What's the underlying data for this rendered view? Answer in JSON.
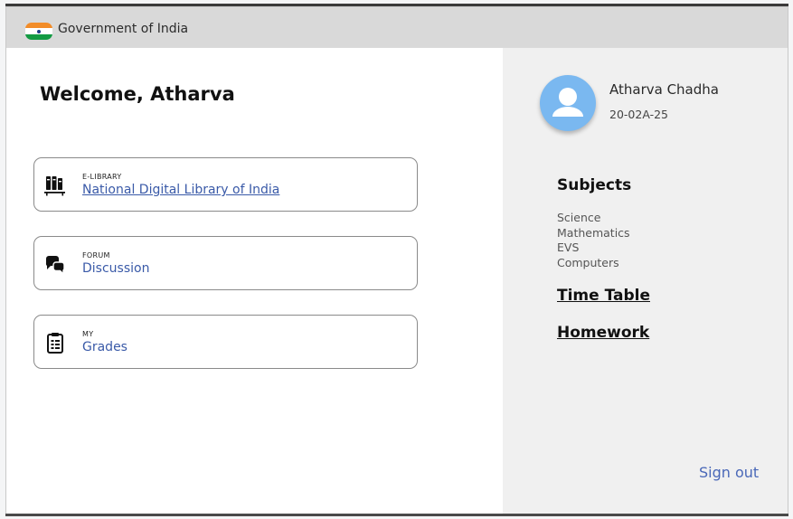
{
  "gov_bar": {
    "label": "Government of India"
  },
  "main": {
    "welcome": "Welcome, Atharva",
    "cards": [
      {
        "tag": "E-LIBRARY",
        "link": "National Digital Library of India",
        "icon": "books-icon"
      },
      {
        "tag": "FORUM",
        "link": "Discussion",
        "icon": "chat-bubbles-icon"
      },
      {
        "tag": "MY",
        "link": "Grades",
        "icon": "clipboard-icon"
      }
    ]
  },
  "sidebar": {
    "user_name": "Atharva Chadha",
    "user_id": "20-02A-25",
    "subjects_heading": "Subjects",
    "subjects": [
      "Science",
      "Mathematics",
      "EVS",
      "Computers"
    ],
    "time_table": "Time Table",
    "homework": "Homework",
    "sign_out": "Sign out"
  },
  "colors": {
    "gov_bar": "#d9d9d9",
    "link": "#3a5aa8",
    "sidebar_bg": "#f0f0f0",
    "avatar": "#7ab8f0",
    "flag_saffron": "#f28c28",
    "flag_green": "#139a43"
  }
}
